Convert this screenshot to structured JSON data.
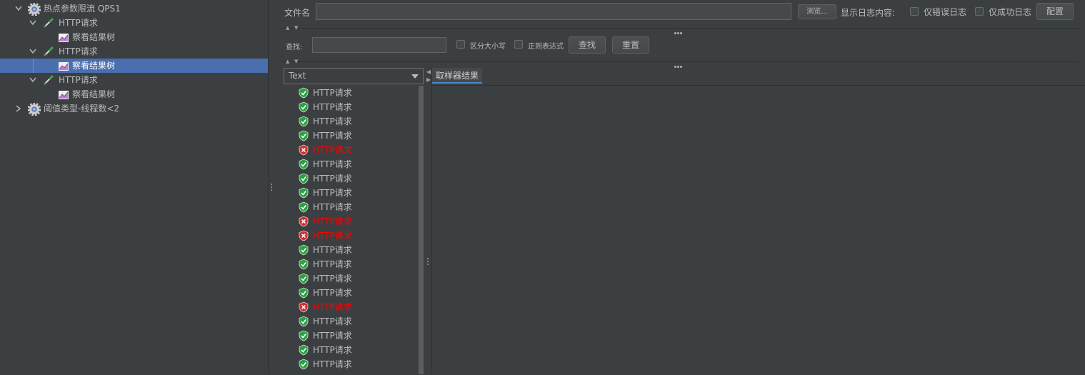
{
  "tree": {
    "items": [
      {
        "label": "热点参数限流 QPS1",
        "icon": "gear-icon",
        "expanded": true
      },
      {
        "label": "HTTP请求",
        "icon": "pipette-icon",
        "expanded": true
      },
      {
        "label": "察看结果树",
        "icon": "chart-icon"
      },
      {
        "label": "HTTP请求",
        "icon": "pipette-icon",
        "expanded": true
      },
      {
        "label": "察看结果树",
        "icon": "chart-icon",
        "selected": true
      },
      {
        "label": "HTTP请求",
        "icon": "pipette-icon",
        "expanded": true
      },
      {
        "label": "察看结果树",
        "icon": "chart-icon"
      },
      {
        "label": "阈值类型-线程数<2",
        "icon": "gear-icon",
        "expanded": false
      }
    ]
  },
  "file": {
    "label": "文件名",
    "value": "",
    "browse_label": "浏览...",
    "log_label": "显示日志内容:",
    "errors_only_label": "仅错误日志",
    "success_only_label": "仅成功日志",
    "config_label": "配置"
  },
  "search": {
    "label": "查找:",
    "value": "",
    "case_label": "区分大小写",
    "regex_label": "正则表达式",
    "find_label": "查找",
    "reset_label": "重置"
  },
  "renderer": {
    "selected": "Text"
  },
  "tab": {
    "label": "取样器结果"
  },
  "results": {
    "items": [
      {
        "label": "HTTP请求",
        "status": "ok"
      },
      {
        "label": "HTTP请求",
        "status": "ok"
      },
      {
        "label": "HTTP请求",
        "status": "ok"
      },
      {
        "label": "HTTP请求",
        "status": "ok"
      },
      {
        "label": "HTTP请求",
        "status": "fail"
      },
      {
        "label": "HTTP请求",
        "status": "ok"
      },
      {
        "label": "HTTP请求",
        "status": "ok"
      },
      {
        "label": "HTTP请求",
        "status": "ok"
      },
      {
        "label": "HTTP请求",
        "status": "ok"
      },
      {
        "label": "HTTP请求",
        "status": "fail"
      },
      {
        "label": "HTTP请求",
        "status": "fail"
      },
      {
        "label": "HTTP请求",
        "status": "ok"
      },
      {
        "label": "HTTP请求",
        "status": "ok"
      },
      {
        "label": "HTTP请求",
        "status": "ok"
      },
      {
        "label": "HTTP请求",
        "status": "ok"
      },
      {
        "label": "HTTP请求",
        "status": "fail"
      },
      {
        "label": "HTTP请求",
        "status": "ok"
      },
      {
        "label": "HTTP请求",
        "status": "ok"
      },
      {
        "label": "HTTP请求",
        "status": "ok"
      },
      {
        "label": "HTTP请求",
        "status": "ok"
      }
    ]
  },
  "colors": {
    "background": "#3c3f41",
    "selection": "#4b6eaf",
    "success": "#2ea043",
    "failure": "#d12f2f",
    "fail_text": "#ff0000"
  }
}
